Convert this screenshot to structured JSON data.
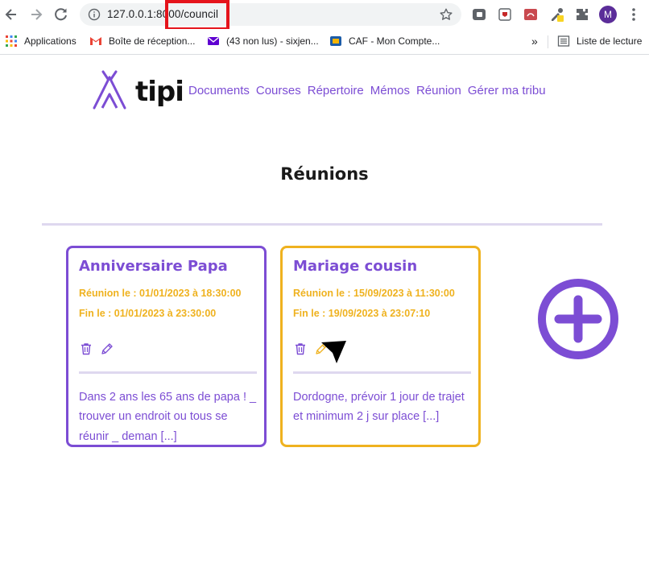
{
  "browser": {
    "url": "127.0.0.1:8000/council",
    "avatar_letter": "M",
    "bookmarks": [
      {
        "label": "Applications",
        "icon": "apps-grid-icon"
      },
      {
        "label": "Boîte de réception...",
        "icon": "gmail-icon"
      },
      {
        "label": "(43 non lus) - sixjen...",
        "icon": "yahoo-mail-icon"
      },
      {
        "label": "CAF - Mon Compte...",
        "icon": "caf-icon"
      }
    ],
    "overflow_label": "»",
    "reading_list": "Liste de lecture"
  },
  "site": {
    "brand": "tipi",
    "nav": [
      "Documents",
      "Courses",
      "Répertoire",
      "Mémos",
      "Réunion",
      "Gérer ma tribu"
    ]
  },
  "page": {
    "title": "Réunions"
  },
  "meetings": [
    {
      "title": "Anniversaire Papa",
      "dates": "Réunion le : 01/01/2023 à 18:30:00 Fin le : 01/01/2023 à 23:30:00",
      "description": "Dans 2 ans les 65 ans de papa ! _ trouver un endroit ou tous se réunir _ deman [...]",
      "border_color": "#7c4dd4"
    },
    {
      "title": "Mariage cousin",
      "dates": "Réunion le : 15/09/2023 à 11:30:00 Fin le : 19/09/2023 à 23:07:10",
      "description": "Dordogne, prévoir 1 jour de trajet et minimum 2 j sur place [...]",
      "border_color": "#efb21f"
    }
  ],
  "colors": {
    "accent": "#7c4dd4",
    "highlight": "#efb21f",
    "divider": "#ded8ef",
    "annotation_box": "#e5131b"
  }
}
